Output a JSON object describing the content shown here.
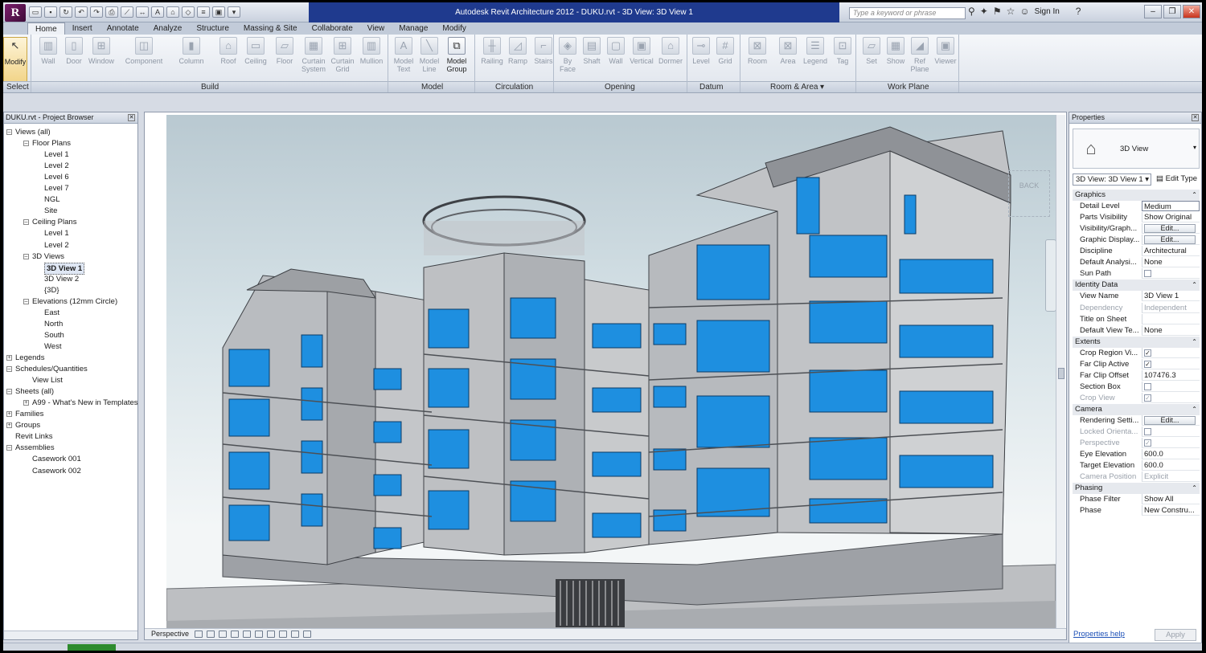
{
  "titlebar": {
    "title": "Autodesk Revit Architecture 2012  -  DUKU.rvt - 3D View: 3D View 1",
    "search_placeholder": "Type a keyword or phrase",
    "sign_in": "Sign In"
  },
  "tabs": [
    "Home",
    "Insert",
    "Annotate",
    "Analyze",
    "Structure",
    "Massing & Site",
    "Collaborate",
    "View",
    "Manage",
    "Modify"
  ],
  "ribbon": {
    "modify": "Modify",
    "build": [
      "Wall",
      "Door",
      "Window",
      "Component",
      "Column",
      "Roof",
      "Ceiling",
      "Floor",
      "Curtain System",
      "Curtain Grid",
      "Mullion"
    ],
    "model": [
      "Model Text",
      "Model Line",
      "Model Group"
    ],
    "circulation": [
      "Railing",
      "Ramp",
      "Stairs"
    ],
    "opening": [
      "By Face",
      "Shaft",
      "Wall",
      "Vertical",
      "Dormer"
    ],
    "datum": [
      "Level",
      "Grid"
    ],
    "room_area": [
      "Room",
      "Area",
      "Legend",
      "Tag"
    ],
    "work_plane": [
      "Set",
      "Show",
      "Ref Plane",
      "Viewer"
    ],
    "panels": [
      "Select",
      "Build",
      "Model",
      "Circulation",
      "Opening",
      "Datum",
      "Room & Area",
      "Work Plane"
    ]
  },
  "browser": {
    "title": "DUKU.rvt - Project Browser",
    "items": [
      "Views (all)",
      "Floor Plans",
      "Level 1",
      "Level 2",
      "Level 6",
      "Level 7",
      "NGL",
      "Site",
      "Ceiling Plans",
      "Level 1",
      "Level 2",
      "3D Views",
      "3D View 1",
      "3D View 2",
      "{3D}",
      "Elevations (12mm Circle)",
      "East",
      "North",
      "South",
      "West",
      "Legends",
      "Schedules/Quantities",
      "View List",
      "Sheets (all)",
      "A99 - What's New in Templates",
      "Families",
      "Groups",
      "Revit Links",
      "Assemblies",
      "Casework 001",
      "Casework 002"
    ]
  },
  "view": {
    "footer_label": "Perspective",
    "viewcube_face": "BACK"
  },
  "properties": {
    "title": "Properties",
    "type_name": "3D View",
    "instance_selector": "3D View: 3D View 1",
    "edit_type": "Edit Type",
    "groups": {
      "graphics": "Graphics",
      "identity": "Identity Data",
      "extents": "Extents",
      "camera": "Camera",
      "phasing": "Phasing"
    },
    "rows": {
      "detail_level": [
        "Detail Level",
        "Medium"
      ],
      "parts_visibility": [
        "Parts Visibility",
        "Show Original"
      ],
      "visibility_graphics": [
        "Visibility/Graph...",
        "Edit..."
      ],
      "graphic_display": [
        "Graphic Display...",
        "Edit..."
      ],
      "discipline": [
        "Discipline",
        "Architectural"
      ],
      "default_analysis": [
        "Default Analysi...",
        "None"
      ],
      "sun_path": [
        "Sun Path",
        ""
      ],
      "view_name": [
        "View Name",
        "3D View 1"
      ],
      "dependency": [
        "Dependency",
        "Independent"
      ],
      "title_on_sheet": [
        "Title on Sheet",
        ""
      ],
      "default_view_template": [
        "Default View Te...",
        "None"
      ],
      "crop_region_visible": [
        "Crop Region Vi...",
        "✓"
      ],
      "far_clip_active": [
        "Far Clip Active",
        "✓"
      ],
      "far_clip_offset": [
        "Far Clip Offset",
        "107476.3"
      ],
      "section_box": [
        "Section Box",
        ""
      ],
      "crop_view": [
        "Crop View",
        "✓"
      ],
      "rendering_settings": [
        "Rendering Setti...",
        "Edit..."
      ],
      "locked_orientation": [
        "Locked Orienta...",
        ""
      ],
      "perspective": [
        "Perspective",
        "✓"
      ],
      "eye_elevation": [
        "Eye Elevation",
        "600.0"
      ],
      "target_elevation": [
        "Target Elevation",
        "600.0"
      ],
      "camera_position": [
        "Camera Position",
        "Explicit"
      ],
      "phase_filter": [
        "Phase Filter",
        "Show All"
      ],
      "phase": [
        "Phase",
        "New Constru..."
      ]
    },
    "help": "Properties help",
    "apply": "Apply"
  },
  "colors": {
    "title_blue": "#1f3a8e",
    "glass_blue": "#1e8fe0",
    "wall_gray": "#b9bcc0"
  }
}
